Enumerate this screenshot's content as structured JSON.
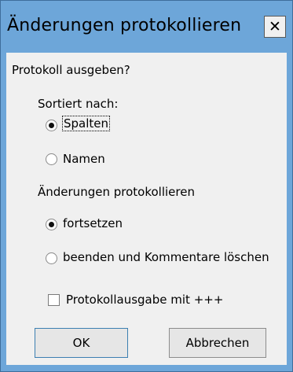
{
  "window": {
    "title": "Änderungen protokollieren",
    "close_glyph": "✕"
  },
  "dialog": {
    "prompt": "Protokoll ausgeben?",
    "sort_group": {
      "label": "Sortiert nach:",
      "options": [
        {
          "label": "Spalten",
          "selected": true
        },
        {
          "label": "Namen",
          "selected": false
        }
      ]
    },
    "changes_group": {
      "label": "Änderungen protokollieren",
      "options": [
        {
          "label": "fortsetzen",
          "selected": true
        },
        {
          "label": "beenden und Kommentare löschen",
          "selected": false
        }
      ]
    },
    "checkbox": {
      "label": "Protokollausgabe mit +++",
      "checked": false
    },
    "buttons": {
      "ok": "OK",
      "cancel": "Abbrechen"
    }
  },
  "colors": {
    "titlebar": "#6da6d9",
    "client": "#f0f0f0"
  }
}
